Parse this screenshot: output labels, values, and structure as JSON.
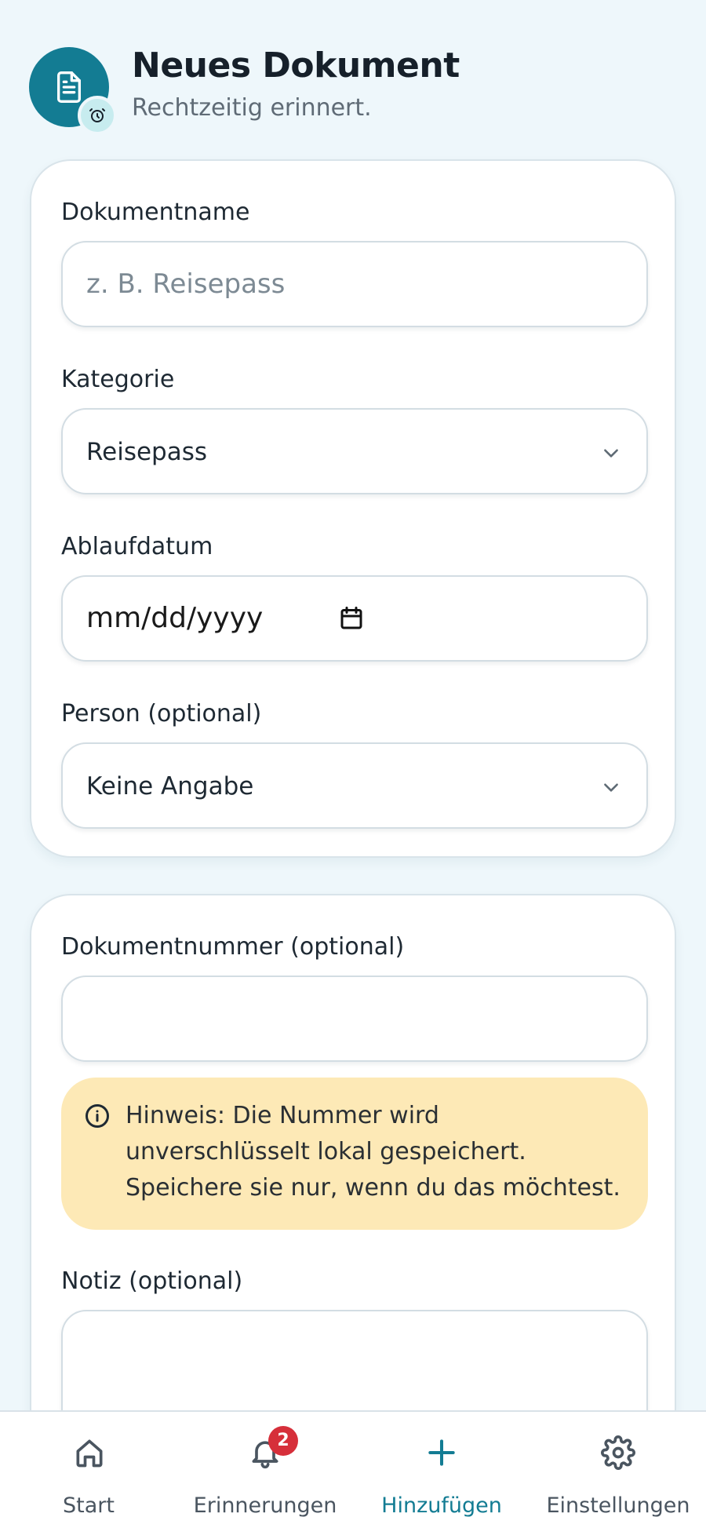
{
  "header": {
    "title": "Neues Dokument",
    "subtitle": "Rechtzeitig erinnert."
  },
  "form": {
    "document_name": {
      "label": "Dokumentname",
      "placeholder": "z. B. Reisepass",
      "value": ""
    },
    "category": {
      "label": "Kategorie",
      "value": "Reisepass"
    },
    "expiry_date": {
      "label": "Ablaufdatum",
      "value": "mm/dd/yyyy"
    },
    "person": {
      "label": "Person (optional)",
      "value": "Keine Angabe"
    },
    "document_number": {
      "label": "Dokumentnummer (optional)",
      "value": ""
    },
    "notice": {
      "text": "Hinweis: Die Nummer wird unverschlüsselt lokal gespeichert. Speichere sie nur, wenn du das möchtest."
    },
    "note": {
      "label": "Notiz (optional)",
      "value": ""
    }
  },
  "nav": {
    "items": [
      {
        "label": "Start",
        "icon": "home-icon"
      },
      {
        "label": "Erinnerungen",
        "icon": "bell-icon",
        "badge": "2"
      },
      {
        "label": "Hinzufügen",
        "icon": "plus-icon",
        "active": true
      },
      {
        "label": "Einstellungen",
        "icon": "gear-icon"
      }
    ]
  },
  "colors": {
    "accent": "#137c93",
    "background": "#eef7fb",
    "notice_bg": "#fde9b6",
    "badge": "#d62f3a"
  }
}
